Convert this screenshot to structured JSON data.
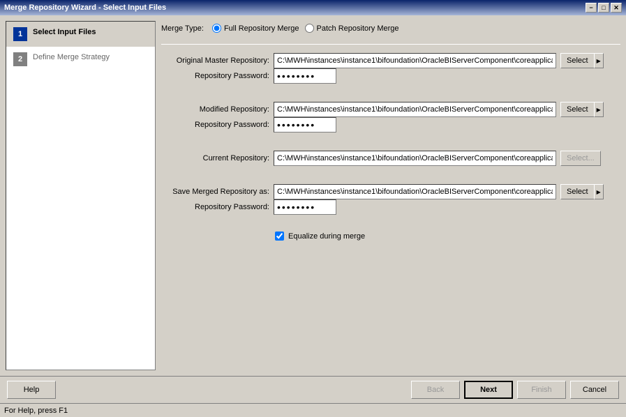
{
  "titlebar": {
    "title": "Merge Repository Wizard - Select Input Files",
    "buttons": {
      "minimize": "−",
      "maximize": "□",
      "close": "✕"
    }
  },
  "sidebar": {
    "items": [
      {
        "number": "1",
        "label": "Select Input Files",
        "state": "active"
      },
      {
        "number": "2",
        "label": "Define Merge Strategy",
        "state": "inactive"
      }
    ]
  },
  "form": {
    "merge_type_label": "Merge Type:",
    "radio_full": "Full Repository Merge",
    "radio_patch": "Patch Repository Merge",
    "original_master_label": "Original Master Repository:",
    "original_master_path": "C:\\MWH\\instances\\instance1\\bifoundation\\OracleBIServerComponent\\coreapplicatio",
    "original_master_password_label": "Repository Password:",
    "original_master_password": "••••••••",
    "modified_repo_label": "Modified Repository:",
    "modified_repo_path": "C:\\MWH\\instances\\instance1\\bifoundation\\OracleBIServerComponent\\coreapplicatio",
    "modified_repo_password_label": "Repository Password:",
    "modified_repo_password": "••••••••",
    "current_repo_label": "Current Repository:",
    "current_repo_path": "C:\\MWH\\instances\\instance1\\bifoundation\\OracleBIServerComponent\\coreapplicatio",
    "save_merged_label": "Save Merged Repository as:",
    "save_merged_path": "C:\\MWH\\instances\\instance1\\bifoundation\\OracleBIServerComponent\\coreapplicatio",
    "save_merged_password_label": "Repository Password:",
    "save_merged_password": "••••••••",
    "equalize_label": "Equalize during merge",
    "select_btn": "Select",
    "select_ellipsis_btn": "Select..."
  },
  "buttons": {
    "help": "Help",
    "back": "Back",
    "next": "Next",
    "finish": "Finish",
    "cancel": "Cancel"
  },
  "statusbar": {
    "text": "For Help, press F1"
  }
}
